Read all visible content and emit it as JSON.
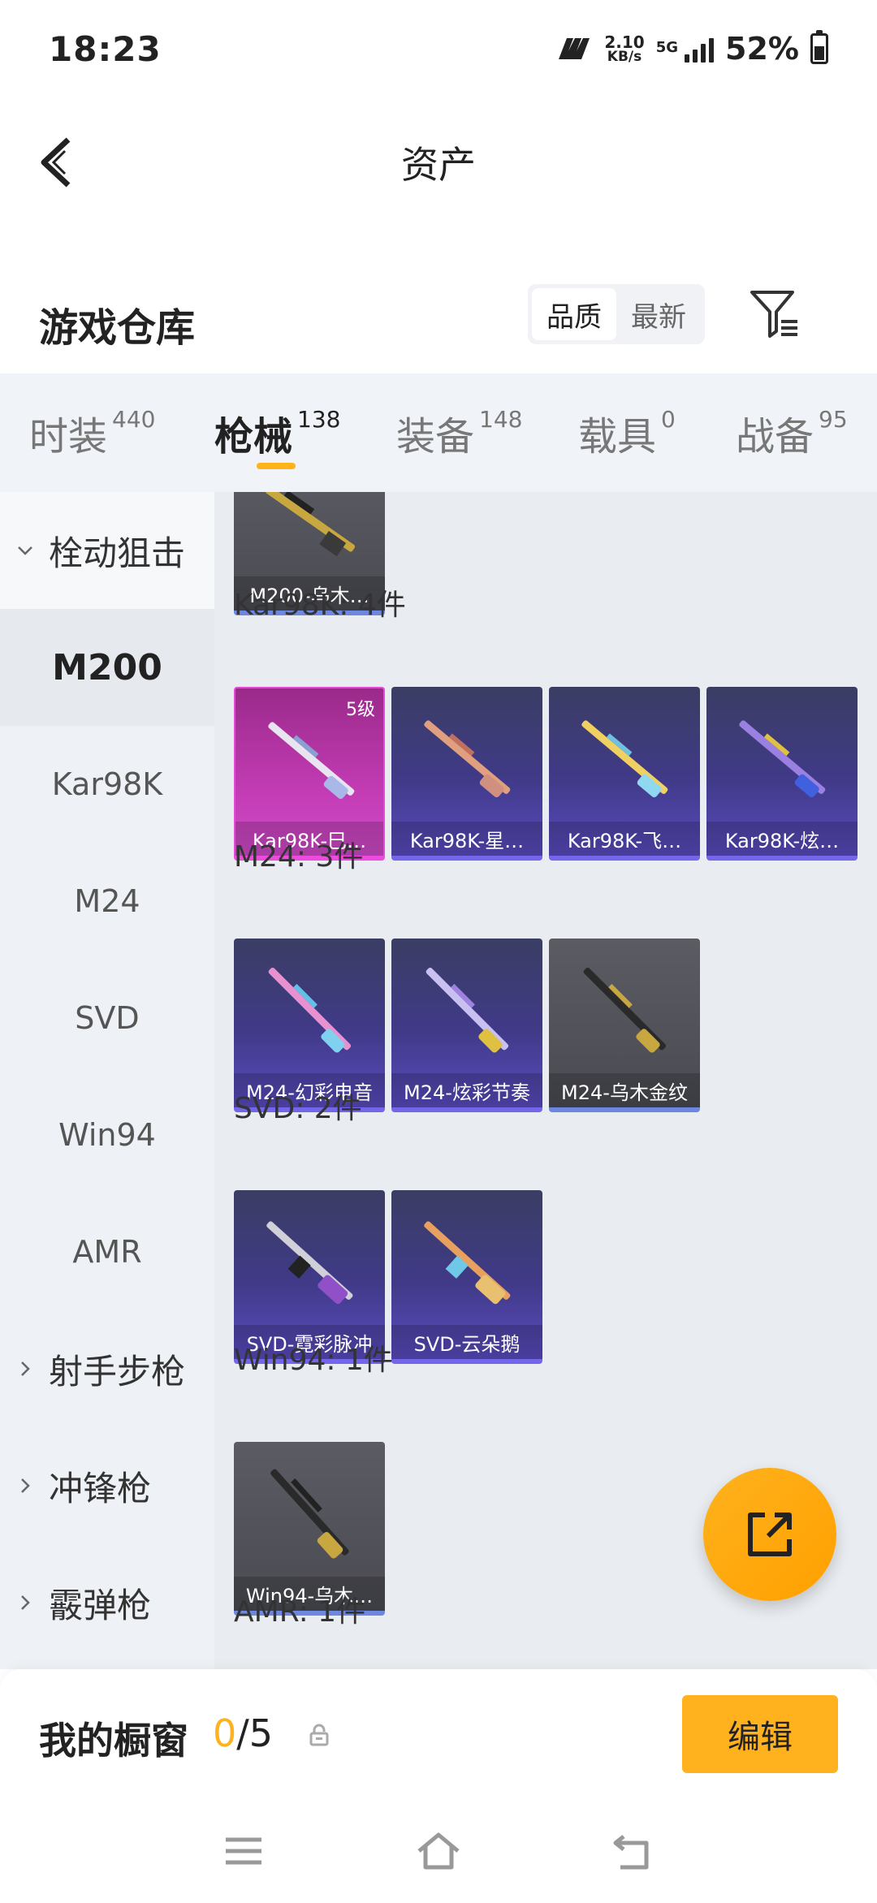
{
  "status_bar": {
    "time": "18:23",
    "net_speed_value": "2.10",
    "net_speed_unit": "KB/s",
    "network_gen": "5G",
    "battery_percent": "52%",
    "battery_level": 0.52
  },
  "header": {
    "title": "资产"
  },
  "warehouse": {
    "title": "游戏仓库",
    "sort_options": [
      "品质",
      "最新"
    ],
    "sort_selected": "品质"
  },
  "tabs": [
    {
      "label": "时装",
      "count": "440"
    },
    {
      "label": "枪械",
      "count": "138",
      "active": true
    },
    {
      "label": "装备",
      "count": "148"
    },
    {
      "label": "载具",
      "count": "0"
    },
    {
      "label": "战备",
      "count": "95"
    }
  ],
  "sidebar": {
    "items": [
      {
        "label": "栓动狙击",
        "type": "group",
        "expanded": true
      },
      {
        "label": "M200",
        "type": "sub",
        "selected": true
      },
      {
        "label": "Kar98K",
        "type": "sub"
      },
      {
        "label": "M24",
        "type": "sub"
      },
      {
        "label": "SVD",
        "type": "sub"
      },
      {
        "label": "Win94",
        "type": "sub"
      },
      {
        "label": "AMR",
        "type": "sub"
      },
      {
        "label": "射手步枪",
        "type": "group"
      },
      {
        "label": "冲锋枪",
        "type": "group"
      },
      {
        "label": "霰弹枪",
        "type": "group"
      }
    ]
  },
  "content": {
    "sections": [
      {
        "title": "",
        "items": [
          {
            "name": "M200-乌木…",
            "quality": "gray"
          }
        ]
      },
      {
        "title": "Kar98K: 4件",
        "items": [
          {
            "name": "Kar98K-巳…",
            "quality": "pink",
            "badge": "5级"
          },
          {
            "name": "Kar98K-星…",
            "quality": "purple"
          },
          {
            "name": "Kar98K-飞…",
            "quality": "purple"
          },
          {
            "name": "Kar98K-炫…",
            "quality": "purple"
          }
        ]
      },
      {
        "title": "M24: 3件",
        "items": [
          {
            "name": "M24-幻彩电音",
            "quality": "purple"
          },
          {
            "name": "M24-炫彩节奏",
            "quality": "purple"
          },
          {
            "name": "M24-乌木金纹",
            "quality": "gray"
          }
        ]
      },
      {
        "title": "SVD: 2件",
        "items": [
          {
            "name": "SVD-霓彩脉冲",
            "quality": "purple"
          },
          {
            "name": "SVD-云朵鹅",
            "quality": "purple"
          }
        ]
      },
      {
        "title": "Win94: 1件",
        "items": [
          {
            "name": "Win94-乌木…",
            "quality": "gray"
          }
        ]
      },
      {
        "title": "AMR: 1件",
        "items": []
      }
    ]
  },
  "showcase": {
    "title": "我的橱窗",
    "current": "0",
    "max": "/5",
    "edit_label": "编辑"
  },
  "colors": {
    "accent": "#ffb21d",
    "purple_quality": "#7466ea",
    "pink_quality": "#ec4bde",
    "gray_quality": "#6d86e0"
  },
  "icons": {
    "back": "chevron-left-icon",
    "filter": "filter-icon",
    "share": "share-external-icon",
    "lock": "lock-icon",
    "nav_menu": "menu-icon",
    "nav_home": "home-icon",
    "nav_back": "back-icon"
  }
}
